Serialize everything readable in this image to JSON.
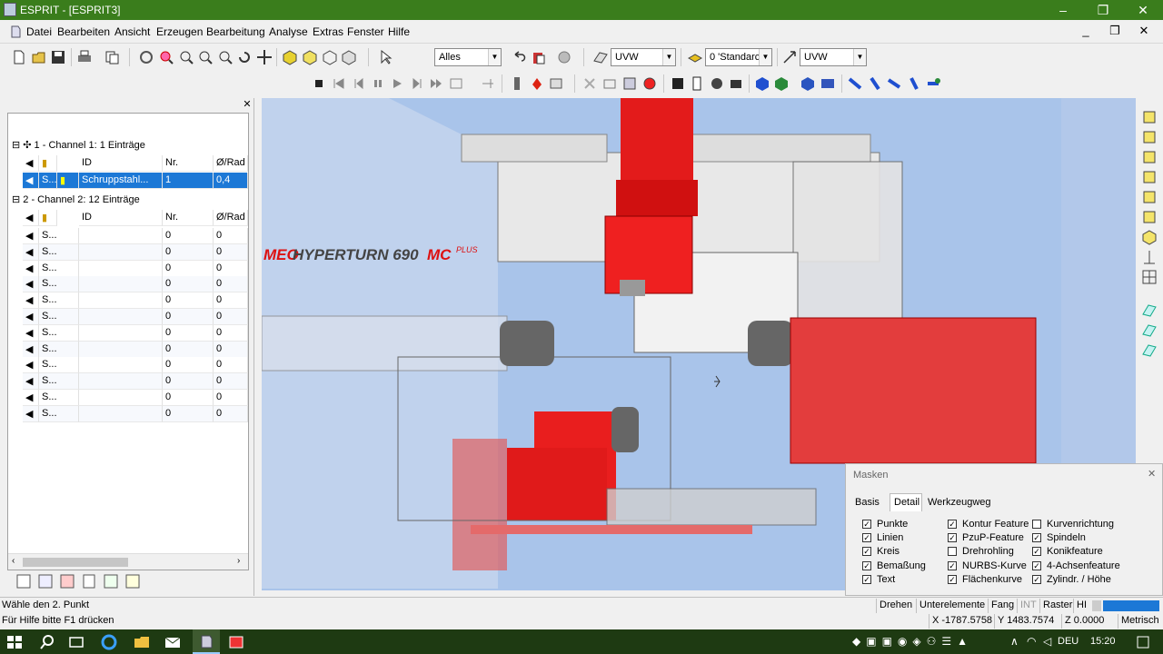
{
  "window": {
    "title": "ESPRIT - [ESPRIT3]",
    "min": "–",
    "max": "❐",
    "close": "✕"
  },
  "menu": [
    "Datei",
    "Bearbeiten",
    "Ansicht",
    "Erzeugen",
    "Bearbeitung",
    "Analyse",
    "Extras",
    "Fenster",
    "Hilfe"
  ],
  "toolbar": {
    "filter_combo": "Alles",
    "uvw1_combo": "UVW",
    "layer_combo": "0 'Standarc",
    "uvw2_combo": "UVW"
  },
  "tree": {
    "channel1": "1 - Channel 1: 1 Einträge",
    "channel2": "2 - Channel 2: 12 Einträge",
    "headers": {
      "id": "ID",
      "nr": "Nr.",
      "rad": "Ø/Rad"
    },
    "ch1_rows": [
      {
        "s": "S...",
        "id": "Schruppstahl...",
        "nr": "1",
        "rad": "0,4"
      }
    ],
    "ch2_rows": [
      {
        "s": "S...",
        "nr": "0",
        "rad": "0"
      },
      {
        "s": "S...",
        "nr": "0",
        "rad": "0"
      },
      {
        "s": "S...",
        "nr": "0",
        "rad": "0"
      },
      {
        "s": "S...",
        "nr": "0",
        "rad": "0"
      },
      {
        "s": "S...",
        "nr": "0",
        "rad": "0"
      },
      {
        "s": "S...",
        "nr": "0",
        "rad": "0"
      },
      {
        "s": "S...",
        "nr": "0",
        "rad": "0"
      },
      {
        "s": "S...",
        "nr": "0",
        "rad": "0"
      },
      {
        "s": "S...",
        "nr": "0",
        "rad": "0"
      },
      {
        "s": "S...",
        "nr": "0",
        "rad": "0"
      },
      {
        "s": "S...",
        "nr": "0",
        "rad": "0"
      },
      {
        "s": "S...",
        "nr": "0",
        "rad": "0"
      }
    ]
  },
  "viewport": {
    "machine_label_a": "MEO",
    "machine_label_b": "HYPERTURN 690",
    "machine_label_c": "MC",
    "machine_label_d": "PLUS"
  },
  "masken": {
    "title": "Masken",
    "tabs": [
      "Basis",
      "Detail",
      "Werkzeugweg"
    ],
    "col1": [
      {
        "label": "Punkte",
        "checked": true
      },
      {
        "label": "Linien",
        "checked": true
      },
      {
        "label": "Kreis",
        "checked": true
      },
      {
        "label": "Bemaßung",
        "checked": true
      },
      {
        "label": "Text",
        "checked": true
      }
    ],
    "col2": [
      {
        "label": "Kontur Feature",
        "checked": true
      },
      {
        "label": "PzuP-Feature",
        "checked": true
      },
      {
        "label": "Drehrohling",
        "checked": false
      },
      {
        "label": "NURBS-Kurve",
        "checked": true
      },
      {
        "label": "Flächenkurve",
        "checked": true
      }
    ],
    "col3": [
      {
        "label": "Kurvenrichtung",
        "checked": false
      },
      {
        "label": "Spindeln",
        "checked": true
      },
      {
        "label": "Konikfeature",
        "checked": true
      },
      {
        "label": "4-Achsenfeature",
        "checked": true
      },
      {
        "label": "Zylindr. / Höhe",
        "checked": true
      }
    ]
  },
  "status": {
    "prompt": "Wähle den 2. Punkt",
    "help": "Für Hilfe bitte F1 drücken",
    "drehen": "Drehen",
    "unterelemente": "Unterelemente",
    "fang": "Fang",
    "int": "INT",
    "raster": "Raster",
    "hl": "HI",
    "x": "X -1787.5758",
    "y": "Y 1483.7574",
    "z": "Z 0.0000",
    "unit": "Metrisch"
  },
  "taskbar": {
    "lang": "DEU",
    "time": "15:20"
  }
}
